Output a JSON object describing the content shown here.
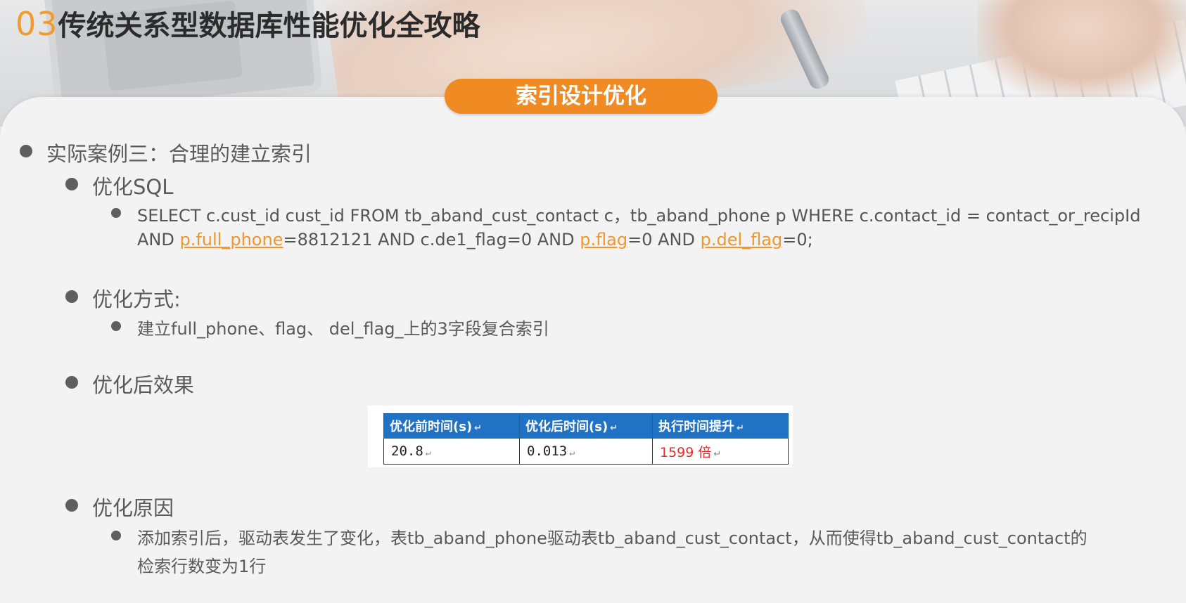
{
  "header": {
    "number": "03",
    "title": "传统关系型数据库性能优化全攻略"
  },
  "section_pill": "索引设计优化",
  "case": {
    "heading": "实际案例三：合理的建立索引",
    "sql_heading": "优化SQL",
    "sql_line1": "SELECT c.cust_id cust_id FROM tb_aband_cust_contact c，tb_aband_phone p WHERE c.contact_id = contact_or_recipId",
    "sql_line2_parts": [
      "AND ",
      "p.full_phone",
      "=8812121 AND c.de1_flag=0 AND ",
      "p.flag",
      "=0 AND ",
      "p.del_flag",
      "=0;"
    ],
    "method_heading": "优化方式:",
    "method_text": "建立full_phone、flag、 del_flag_上的3字段复合索引",
    "effect_heading": "优化后效果",
    "reason_heading": "优化原因",
    "reason_line1": "添加索引后，驱动表发生了变化，表tb_aband_phone驱动表tb_aband_cust_contact，从而使得tb_aband_cust_contact的",
    "reason_line2": "检索行数变为1行"
  },
  "perf_table": {
    "headers": [
      "优化前时间(s)",
      "优化后时间(s)",
      "执行时间提升"
    ],
    "row": [
      "20.8",
      "0.013",
      "1599 倍"
    ],
    "return_mark": "↵"
  },
  "colors": {
    "accent_orange": "#f08a22",
    "table_header_blue": "#1f72c4",
    "highlight_red": "#e32b2b"
  }
}
